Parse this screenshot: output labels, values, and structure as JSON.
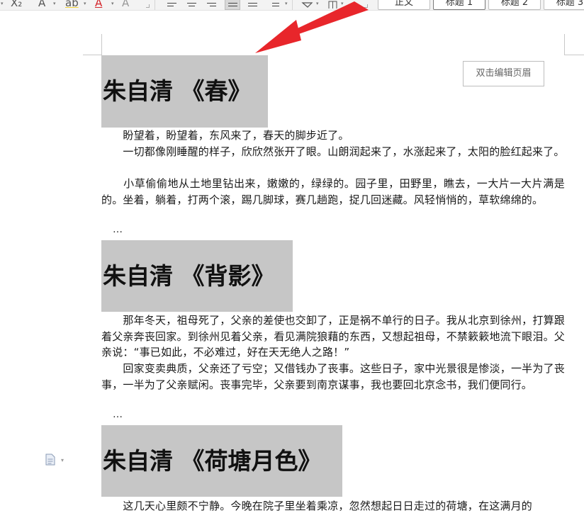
{
  "ribbon": {
    "subscript_label": "X₂",
    "text_effect_label": "A",
    "highlight_label": "ab",
    "font_color_label": "A",
    "clear_format_label": "A",
    "styles": [
      {
        "label": "正文"
      },
      {
        "label": "标题 1"
      },
      {
        "label": "标题 2"
      },
      {
        "label": "标题 3"
      }
    ]
  },
  "page": {
    "header_hint": "双击编辑页眉",
    "sections": [
      {
        "heading": "朱自清 《春》",
        "paragraphs": [
          "　　盼望着，盼望着，东风来了，春天的脚步近了。",
          "　　一切都像刚睡醒的样子，欣欣然张开了眼。山朗润起来了，水涨起来了，太阳的脸红起来了。",
          "　　小草偷偷地从土地里钻出来，嫩嫩的，绿绿的。园子里，田野里，瞧去，一大片一大片满是的。坐着，躺着，打两个滚，踢几脚球，赛几趟跑，捉几回迷藏。风轻悄悄的，草软绵绵的。"
        ],
        "ellipsis": "…"
      },
      {
        "heading": "朱自清 《背影》",
        "paragraphs": [
          "　　那年冬天，祖母死了，父亲的差使也交卸了，正是祸不单行的日子。我从北京到徐州，打算跟着父亲奔丧回家。到徐州见着父亲，看见满院狼藉的东西，又想起祖母，不禁簌簌地流下眼泪。父亲说：“事已如此，不必难过，好在天无绝人之路！”",
          "　　回家变卖典质，父亲还了亏空；又借钱办了丧事。这些日子，家中光景很是惨淡，一半为了丧事，一半为了父亲赋闲。丧事完毕，父亲要到南京谋事，我也要回北京念书，我们便同行。"
        ],
        "ellipsis": "…"
      },
      {
        "heading": "朱自清 《荷塘月色》",
        "paragraphs": [
          "　　这几天心里颇不宁静。今晚在院子里坐着乘凉，忽然想起日日走过的荷塘，在这满月的"
        ]
      }
    ]
  },
  "colors": {
    "heading_highlight": "#c6c6c6",
    "arrow": "#e8262b"
  }
}
